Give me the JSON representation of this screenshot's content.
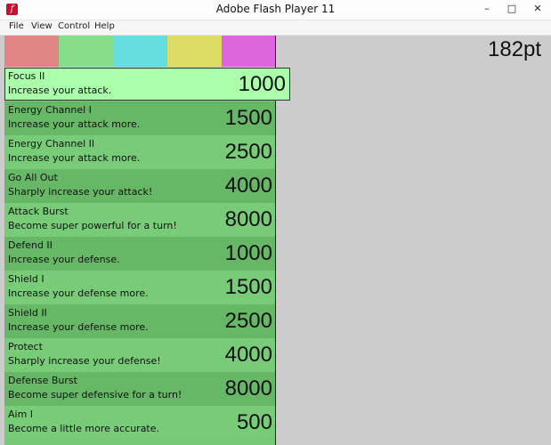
{
  "window": {
    "title": "Adobe Flash Player 11",
    "icon": "flash-player-icon",
    "controls": {
      "minimize": "–",
      "maximize": "□",
      "close": "✕"
    }
  },
  "menu": [
    "File",
    "View",
    "Control",
    "Help"
  ],
  "tabs": [
    {
      "color": "#e08484",
      "active": false
    },
    {
      "color": "#88dd88",
      "active": true
    },
    {
      "color": "#66dddd",
      "active": false
    },
    {
      "color": "#dddd66",
      "active": false
    },
    {
      "color": "#dd66dd",
      "active": false
    }
  ],
  "points_label": "182pt",
  "skills": [
    {
      "name": "Focus II",
      "desc": "Increase your attack.",
      "cost": "1000",
      "selected": true
    },
    {
      "name": "Energy Channel I",
      "desc": "Increase your attack more.",
      "cost": "1500"
    },
    {
      "name": "Energy Channel II",
      "desc": "Increase your attack more.",
      "cost": "2500"
    },
    {
      "name": "Go All Out",
      "desc": "Sharply increase your attack!",
      "cost": "4000"
    },
    {
      "name": "Attack Burst",
      "desc": "Become super powerful for a turn!",
      "cost": "8000"
    },
    {
      "name": "Defend II",
      "desc": "Increase your defense.",
      "cost": "1000"
    },
    {
      "name": "Shield I",
      "desc": "Increase your defense more.",
      "cost": "1500"
    },
    {
      "name": "Shield II",
      "desc": "Increase your defense more.",
      "cost": "2500"
    },
    {
      "name": "Protect",
      "desc": "Sharply increase your defense!",
      "cost": "4000"
    },
    {
      "name": "Defense Burst",
      "desc": "Become super defensive for a turn!",
      "cost": "8000"
    },
    {
      "name": "Aim I",
      "desc": "Become a little more accurate.",
      "cost": "500"
    }
  ]
}
